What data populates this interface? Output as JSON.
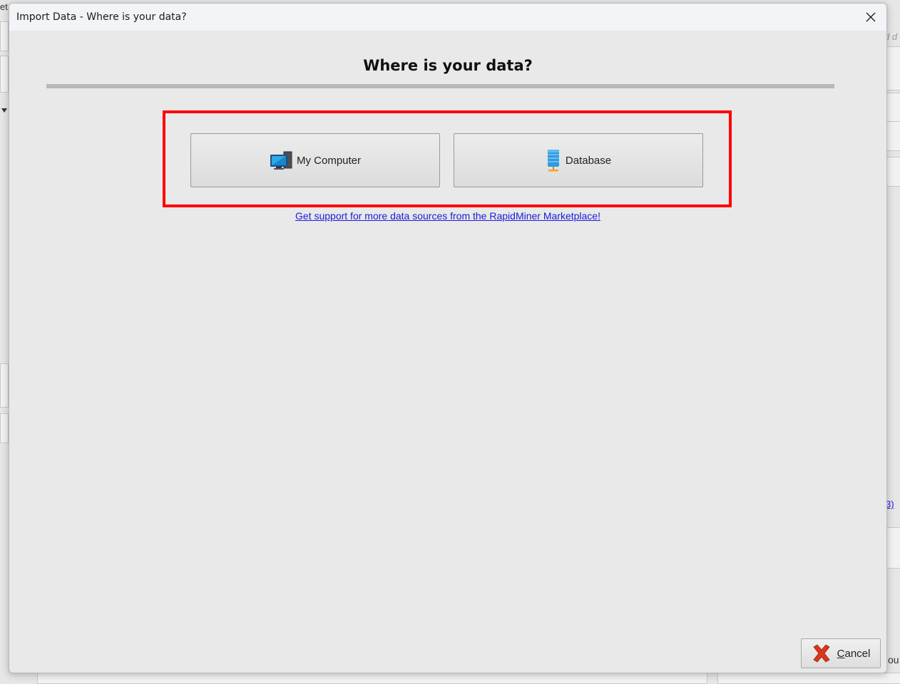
{
  "background": {
    "top_left_fragment": "et",
    "top_right_fragment": "d d",
    "right_link_fragment": "3)",
    "bottom_right_fragment": "ou"
  },
  "dialog": {
    "title": "Import Data - Where is your data?",
    "close_icon": "close-icon",
    "heading": "Where is your data?",
    "sources": [
      {
        "label": "My Computer",
        "icon": "computer-icon"
      },
      {
        "label": "Database",
        "icon": "database-icon"
      }
    ],
    "marketplace_link": "Get support for more data sources from the RapidMiner Marketplace!",
    "cancel": {
      "mnemonic": "C",
      "rest": "ancel",
      "icon": "cancel-x-icon"
    }
  },
  "colors": {
    "highlight": "#ff0000",
    "link": "#1a1adc",
    "cancel_icon": "#d9381e"
  }
}
